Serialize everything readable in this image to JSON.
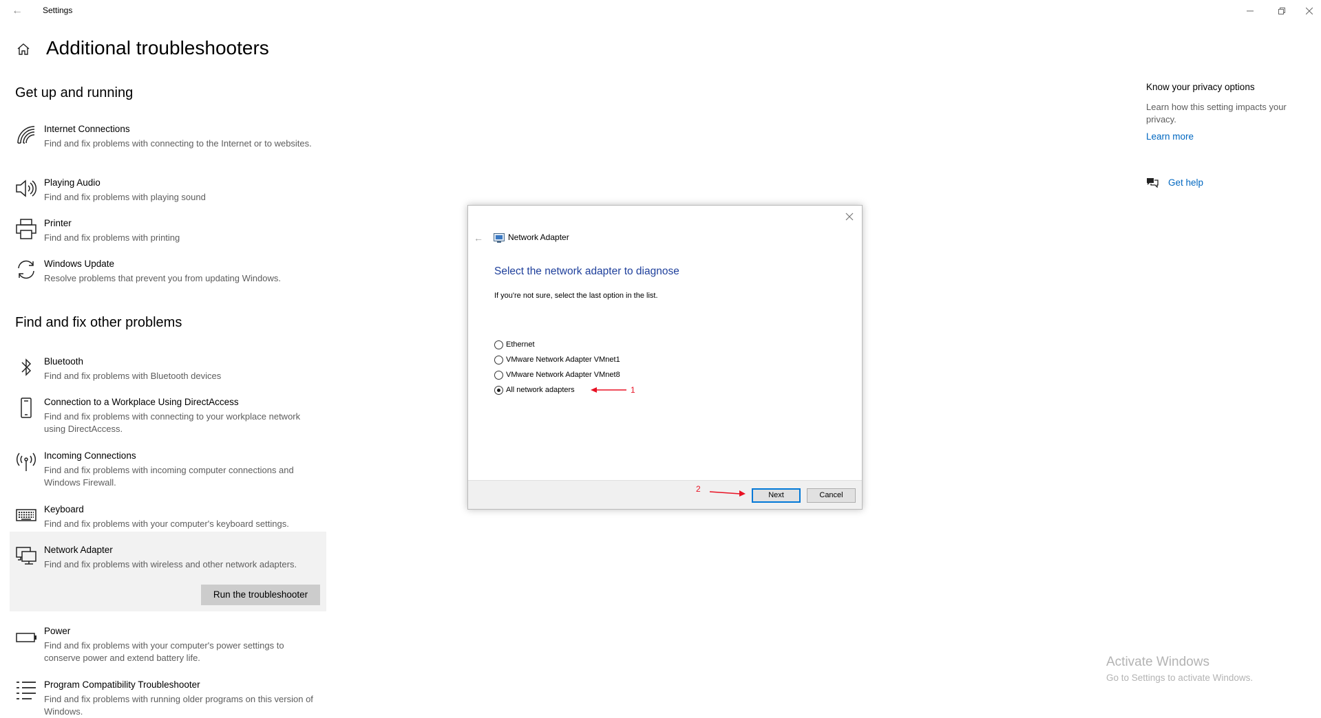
{
  "window": {
    "title": "Settings"
  },
  "page": {
    "title": "Additional troubleshooters"
  },
  "sections": {
    "get_up": "Get up and running",
    "find_fix": "Find and fix other problems"
  },
  "troubleshooters": [
    {
      "icon": "wifi-icon",
      "name": "Internet Connections",
      "desc": "Find and fix problems with connecting to the Internet or to websites."
    },
    {
      "icon": "speaker-icon",
      "name": "Playing Audio",
      "desc": "Find and fix problems with playing sound"
    },
    {
      "icon": "printer-icon",
      "name": "Printer",
      "desc": "Find and fix problems with printing"
    },
    {
      "icon": "sync-icon",
      "name": "Windows Update",
      "desc": "Resolve problems that prevent you from updating Windows."
    },
    {
      "icon": "bluetooth-icon",
      "name": "Bluetooth",
      "desc": "Find and fix problems with Bluetooth devices"
    },
    {
      "icon": "phone-icon",
      "name": "Connection to a Workplace Using DirectAccess",
      "desc": "Find and fix problems with connecting to your workplace network using DirectAccess."
    },
    {
      "icon": "broadcast-icon",
      "name": "Incoming Connections",
      "desc": "Find and fix problems with incoming computer connections and Windows Firewall."
    },
    {
      "icon": "keyboard-icon",
      "name": "Keyboard",
      "desc": "Find and fix problems with your computer's keyboard settings."
    },
    {
      "icon": "network-adapter-icon",
      "name": "Network Adapter",
      "desc": "Find and fix problems with wireless and other network adapters."
    },
    {
      "icon": "battery-icon",
      "name": "Power",
      "desc": "Find and fix problems with your computer's power settings to conserve power and extend battery life."
    },
    {
      "icon": "list-icon",
      "name": "Program Compatibility Troubleshooter",
      "desc": "Find and fix problems with running older programs on this version of Windows."
    }
  ],
  "run_button": "Run the troubleshooter",
  "right_panel": {
    "privacy_title": "Know your privacy options",
    "privacy_text": "Learn how this setting impacts your privacy.",
    "learn_more": "Learn more",
    "get_help": "Get help"
  },
  "watermark": {
    "line1": "Activate Windows",
    "line2": "Go to Settings to activate Windows."
  },
  "dialog": {
    "app_title": "Network Adapter",
    "heading": "Select the network adapter to diagnose",
    "hint": "If you're not sure, select the last option in the list.",
    "options": [
      {
        "label": "Ethernet",
        "checked": false
      },
      {
        "label": "VMware Network Adapter VMnet1",
        "checked": false
      },
      {
        "label": "VMware Network Adapter VMnet8",
        "checked": false
      },
      {
        "label": "All network adapters",
        "checked": true
      }
    ],
    "next": "Next",
    "cancel": "Cancel"
  },
  "annotations": {
    "step1": "1",
    "step2": "2"
  },
  "colors": {
    "accent_link": "#0067c0",
    "dialog_heading": "#1e3f9b",
    "annotation_red": "#e81123",
    "selected_bg": "#f2f2f2"
  }
}
